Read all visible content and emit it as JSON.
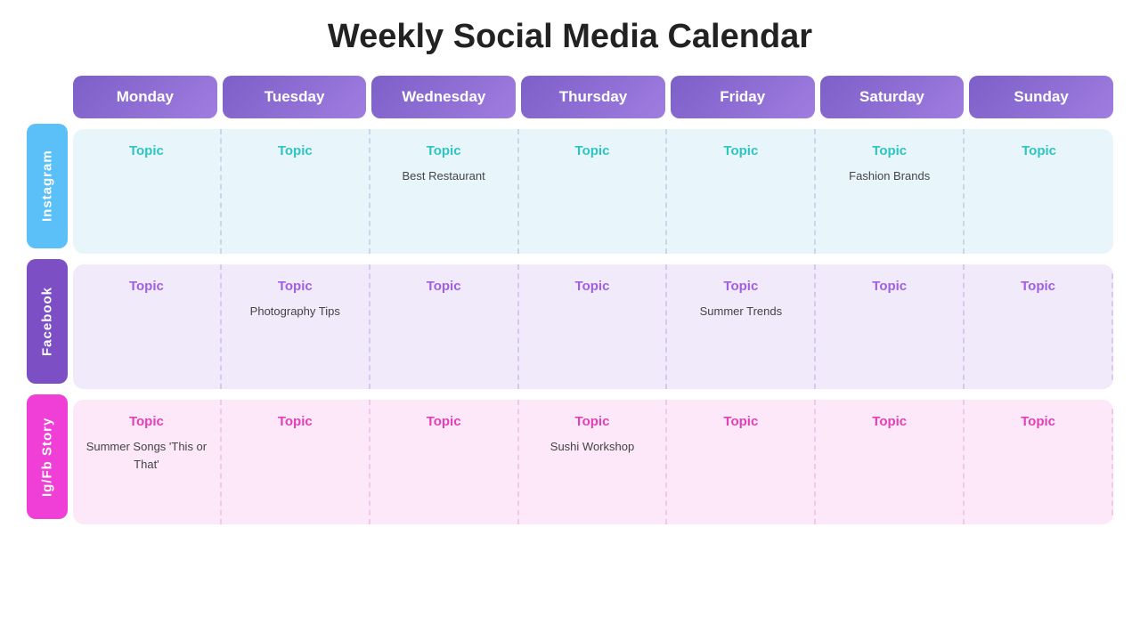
{
  "title": "Weekly Social Media Calendar",
  "days": [
    "Monday",
    "Tuesday",
    "Wednesday",
    "Thursday",
    "Friday",
    "Saturday",
    "Sunday"
  ],
  "rows": [
    {
      "id": "instagram",
      "label": "Instagram",
      "labelClass": "instagram",
      "rowClass": "instagram-row",
      "topicColor": "#2fc4c4",
      "topicLabel": "Topic",
      "cells": [
        {
          "topic": "Topic",
          "content": ""
        },
        {
          "topic": "Topic",
          "content": ""
        },
        {
          "topic": "Topic",
          "content": "Best Restaurant"
        },
        {
          "topic": "Topic",
          "content": ""
        },
        {
          "topic": "Topic",
          "content": ""
        },
        {
          "topic": "Topic",
          "content": "Fashion Brands"
        },
        {
          "topic": "Topic",
          "content": ""
        }
      ]
    },
    {
      "id": "facebook",
      "label": "Facebook",
      "labelClass": "facebook",
      "rowClass": "facebook-row",
      "topicColor": "#a060e0",
      "topicLabel": "Topic",
      "cells": [
        {
          "topic": "Topic",
          "content": ""
        },
        {
          "topic": "Topic",
          "content": "Photography Tips"
        },
        {
          "topic": "Topic",
          "content": ""
        },
        {
          "topic": "Topic",
          "content": ""
        },
        {
          "topic": "Topic",
          "content": "Summer Trends"
        },
        {
          "topic": "Topic",
          "content": ""
        },
        {
          "topic": "Topic",
          "content": ""
        }
      ]
    },
    {
      "id": "igfb",
      "label": "Ig/Fb Story",
      "labelClass": "igfb",
      "rowClass": "igfb-row",
      "topicColor": "#e040b8",
      "topicLabel": "Topic",
      "cells": [
        {
          "topic": "Topic",
          "content": "Summer Songs\n'This or That'"
        },
        {
          "topic": "Topic",
          "content": ""
        },
        {
          "topic": "Topic",
          "content": ""
        },
        {
          "topic": "Topic",
          "content": "Sushi Workshop"
        },
        {
          "topic": "Topic",
          "content": ""
        },
        {
          "topic": "Topic",
          "content": ""
        },
        {
          "topic": "Topic",
          "content": ""
        }
      ]
    }
  ]
}
